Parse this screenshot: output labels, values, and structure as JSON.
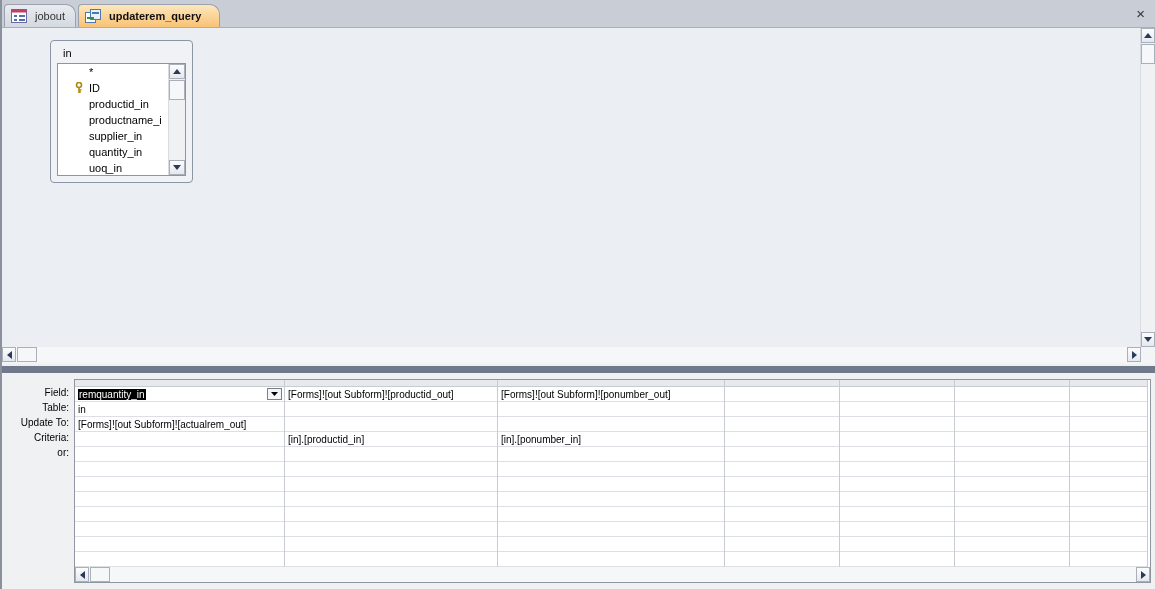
{
  "tabs": [
    {
      "label": "jobout",
      "kind": "form",
      "selected": false
    },
    {
      "label": "updaterem_query",
      "kind": "query",
      "selected": true
    }
  ],
  "close_button": "×",
  "table_box": {
    "title": "in",
    "fields": [
      {
        "name": "*",
        "primary_key": false
      },
      {
        "name": "ID",
        "primary_key": true
      },
      {
        "name": "productid_in",
        "primary_key": false
      },
      {
        "name": "productname_i",
        "primary_key": false
      },
      {
        "name": "supplier_in",
        "primary_key": false
      },
      {
        "name": "quantity_in",
        "primary_key": false
      },
      {
        "name": "uoq_in",
        "primary_key": false
      }
    ]
  },
  "grid": {
    "row_labels": [
      "Field:",
      "Table:",
      "Update To:",
      "Criteria:",
      "or:"
    ],
    "columns": [
      {
        "field": "remquantity_in",
        "table": "in",
        "update_to": "[Forms]![out Subform]![actualrem_out]",
        "selected": true
      },
      {
        "field": "[Forms]![out Subform]![productid_out]",
        "criteria": "[in].[productid_in]",
        "selected": false
      },
      {
        "field": "[Forms]![out Subform]![ponumber_out]",
        "criteria": "[in].[ponumber_in]",
        "selected": false
      }
    ]
  }
}
